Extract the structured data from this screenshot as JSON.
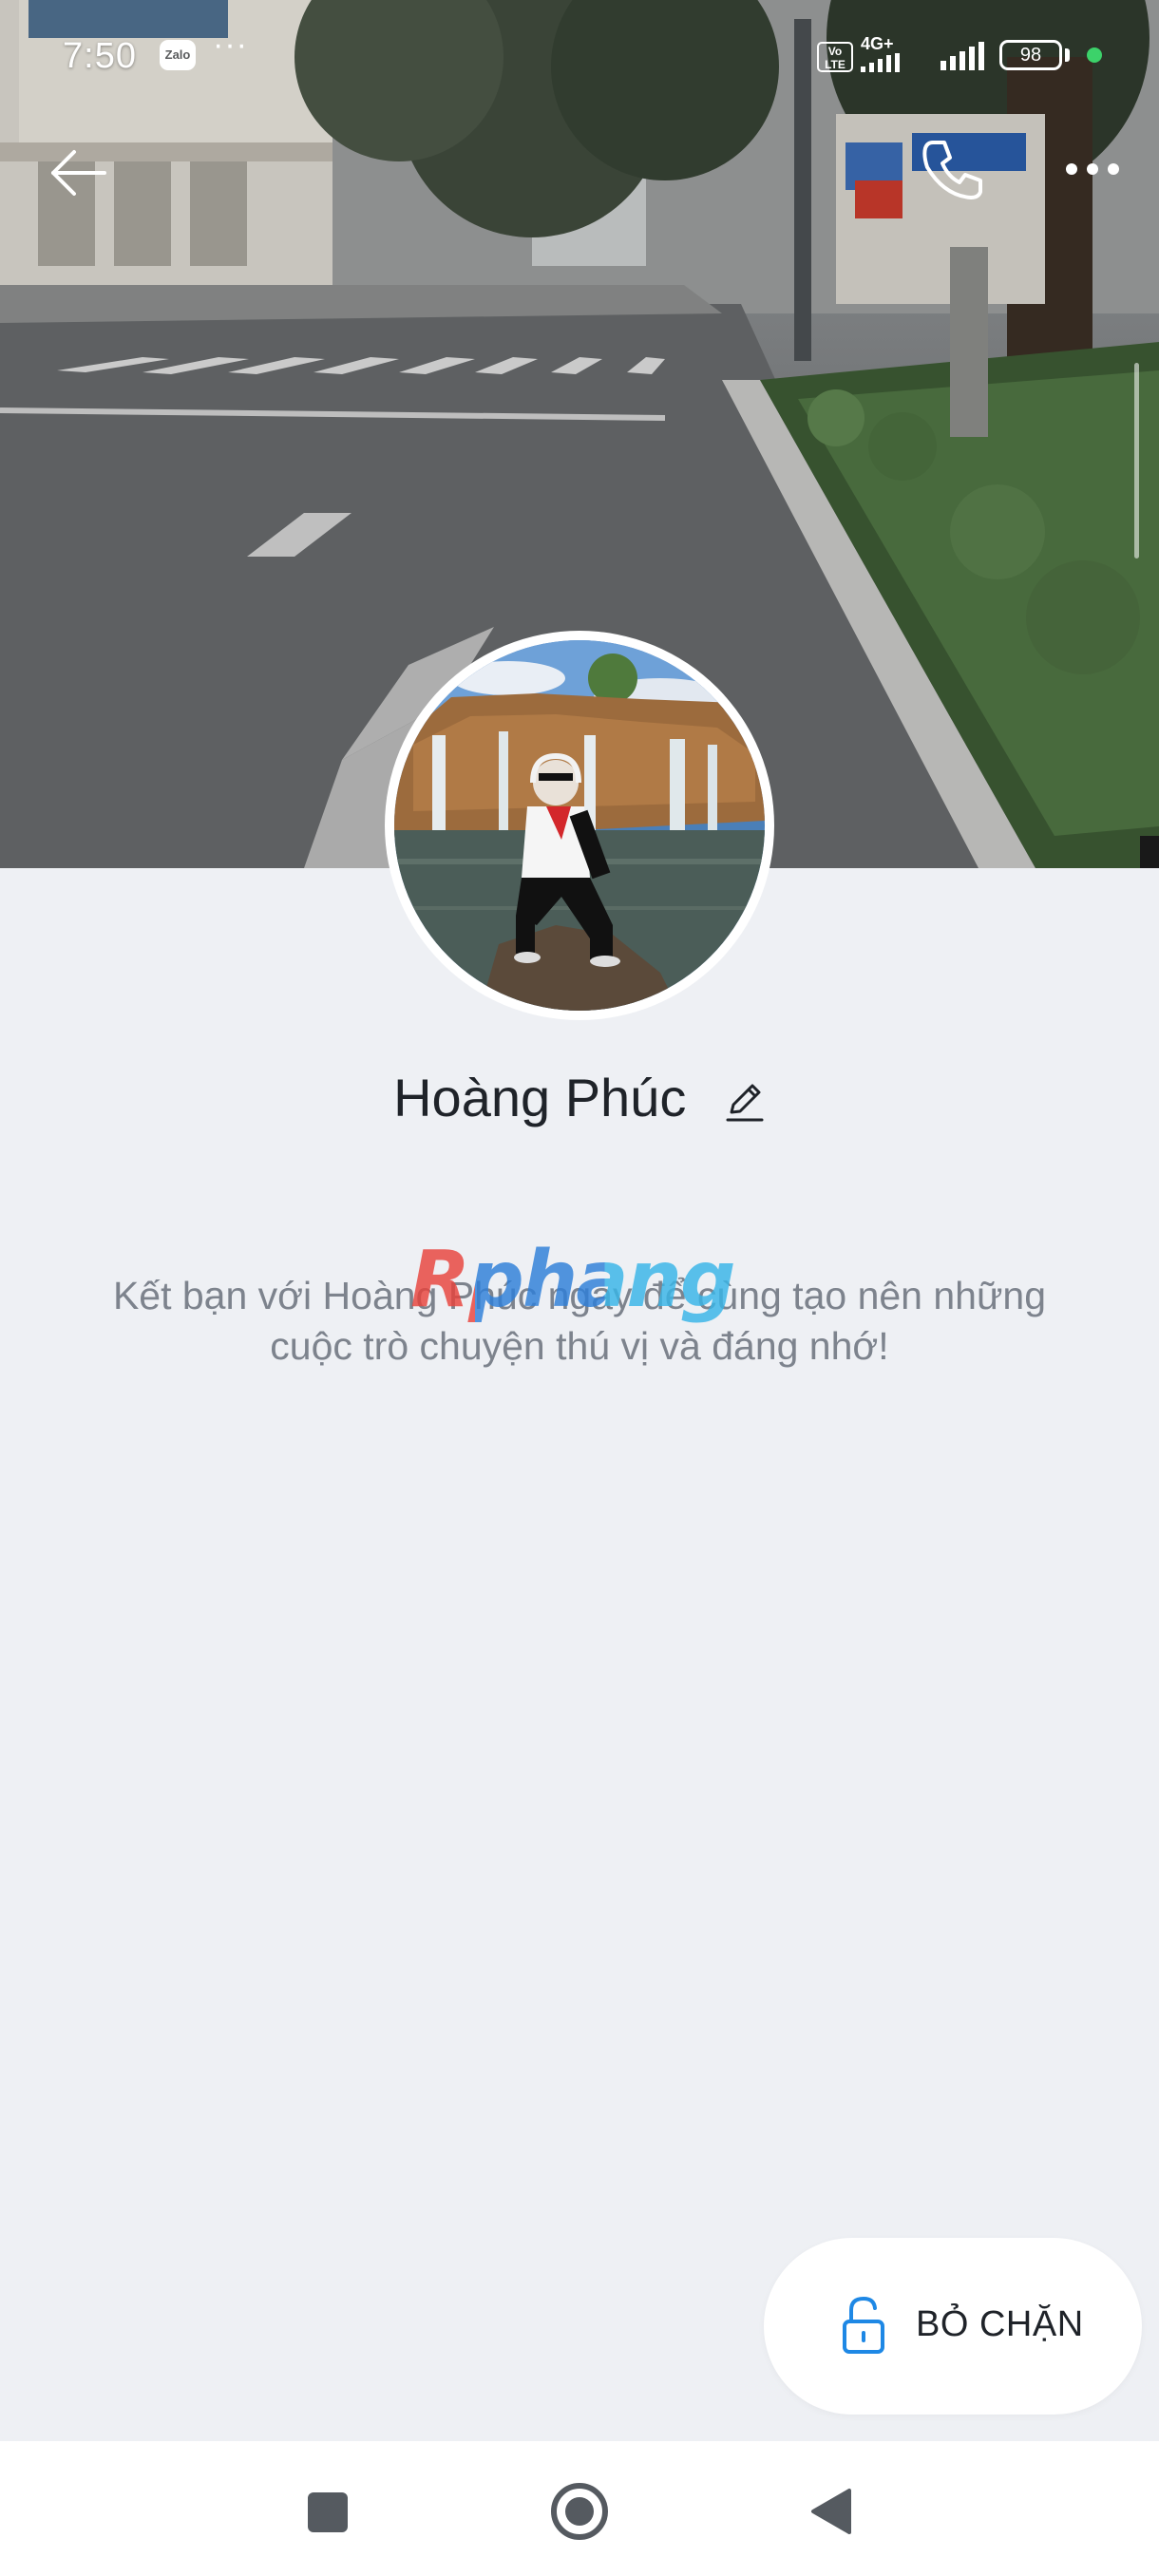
{
  "status_bar": {
    "time": "7:50",
    "app_badge": "Zalo",
    "more_dots": "···",
    "volte": "Vo LTE",
    "network": "4G+",
    "battery": "98"
  },
  "profile": {
    "name": "Hoàng Phúc",
    "invite_text": "Kết bạn với Hoàng Phúc ngay để cùng tạo nên những cuộc trò chuyện thú vị và đáng nhớ!"
  },
  "watermark": "Rphang",
  "actions": {
    "unblock_label": "BỎ CHẶN"
  },
  "icons": {
    "back": "arrow-left-icon",
    "call": "phone-icon",
    "more": "more-horizontal-icon",
    "edit": "pencil-icon",
    "unblock": "unlock-icon",
    "nav_recents": "square-icon",
    "nav_home": "circle-icon",
    "nav_back": "triangle-back-icon"
  },
  "colors": {
    "background": "#eef0f4",
    "accent": "#1e88e5",
    "text_primary": "#1f2329",
    "text_secondary": "#7d838d",
    "online_dot": "#3cd26a"
  }
}
